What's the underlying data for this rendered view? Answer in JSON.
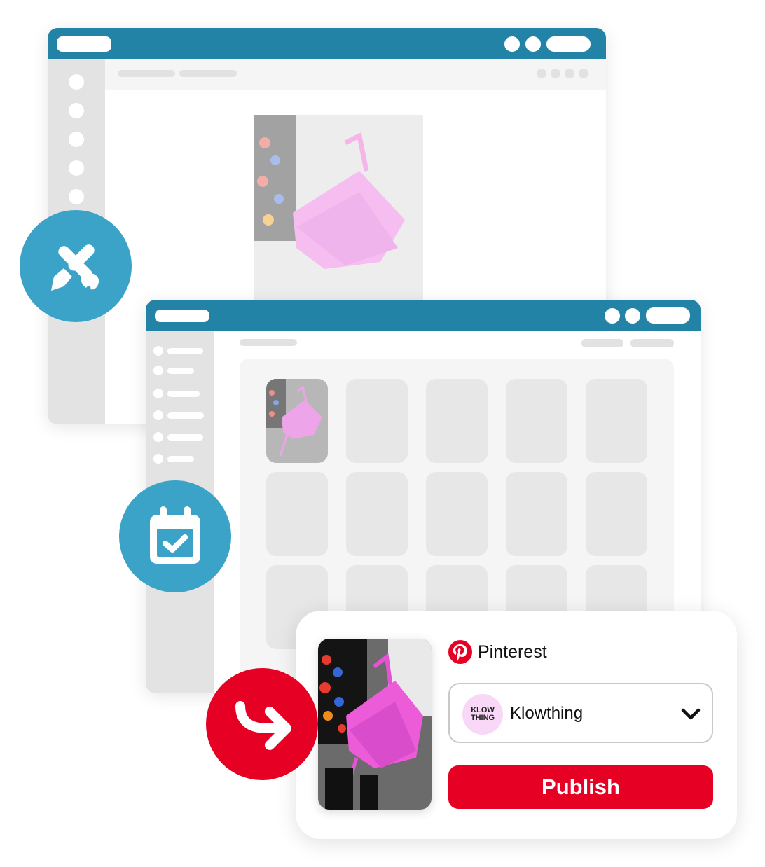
{
  "colors": {
    "titlebar": "#2383a7",
    "badge_blue": "#3ba3c8",
    "pinterest_red": "#e60023",
    "avatar_pink": "#f8d8f6",
    "placeholder_grey": "#e7e7e7"
  },
  "icons": {
    "design": "pencil-brush-icon",
    "schedule": "calendar-check-icon",
    "publish": "curved-arrow-right-icon",
    "platform": "pinterest-logo-icon",
    "dropdown": "chevron-down-icon"
  },
  "publish_card": {
    "platform_name": "Pinterest",
    "account": {
      "avatar_line1": "KLOW",
      "avatar_line2": "THING",
      "name": "Klowthing"
    },
    "publish_label": "Publish"
  }
}
